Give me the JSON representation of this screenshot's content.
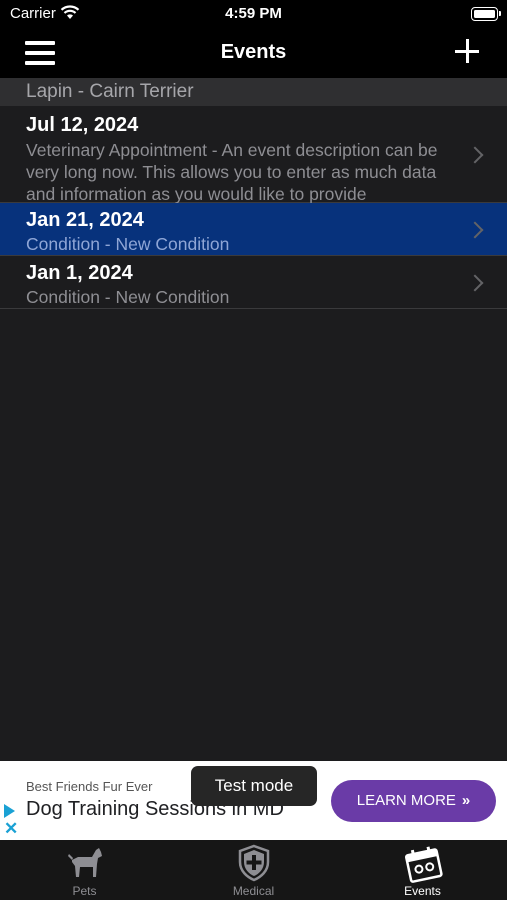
{
  "status_bar": {
    "carrier": "Carrier",
    "time": "4:59 PM"
  },
  "nav": {
    "title": "Events",
    "menu_icon": "hamburger-menu-icon",
    "add_icon": "plus-icon"
  },
  "section": {
    "title": "Lapin - Cairn Terrier"
  },
  "events": [
    {
      "date": "Jul 12, 2024",
      "description": "Veterinary Appointment - An event description can be very long now. This allows you to enter as much data and information as you would like to provide",
      "selected": false
    },
    {
      "date": "Jan 21, 2024",
      "description": "Condition - New Condition",
      "selected": true
    },
    {
      "date": "Jan 1, 2024",
      "description": "Condition - New Condition",
      "selected": false
    }
  ],
  "ad": {
    "sponsor": "Best Friends Fur Ever",
    "title": "Dog Training Sessions in MD",
    "cta": "LEARN MORE",
    "test_mode": "Test mode",
    "cta_color": "#6a3ba7"
  },
  "tabs": [
    {
      "label": "Pets",
      "icon": "dog-icon",
      "active": false
    },
    {
      "label": "Medical",
      "icon": "medical-shield-icon",
      "active": false
    },
    {
      "label": "Events",
      "icon": "calendar-icon",
      "active": true
    }
  ],
  "colors": {
    "selected_row": "#07327c",
    "background": "#1c1c1e"
  }
}
